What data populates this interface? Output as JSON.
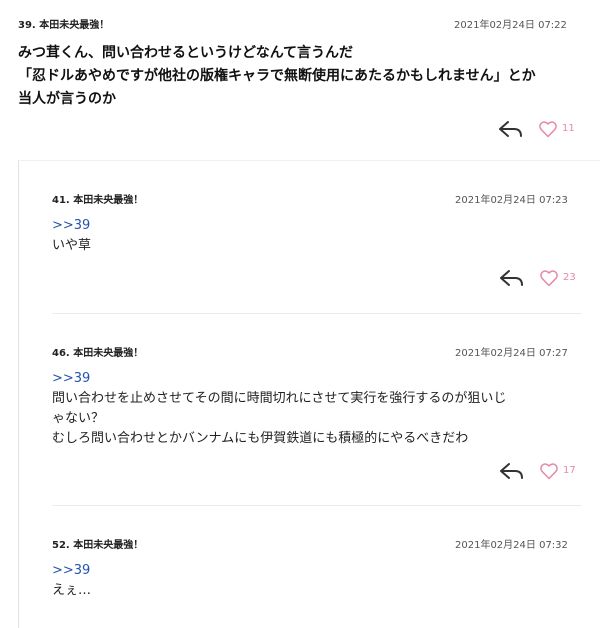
{
  "top_comment": {
    "number": "39.",
    "author": "本田未央最強！",
    "date": "2021年02月24日 07:22",
    "lines": [
      "みつ茸くん、問い合わせるというけどなんて言うんだ",
      "「忍ドルあやめですが他社の版権キャラで無断使用にあたるかもしれません」とか",
      "当人が言うのか"
    ],
    "likes": "11"
  },
  "replies": [
    {
      "number": "41.",
      "author": "本田未央最強！",
      "date": "2021年02月24日 07:23",
      "anchor": ">>39",
      "lines": [
        "いや草"
      ],
      "likes": "23"
    },
    {
      "number": "46.",
      "author": "本田未央最強！",
      "date": "2021年02月24日 07:27",
      "anchor": ">>39",
      "lines": [
        "問い合わせを止めさせてその間に時間切れにさせて実行を強行するのが狙いじ",
        "ゃない？",
        "むしろ問い合わせとかバンナムにも伊賀鉄道にも積極的にやるべきだわ"
      ],
      "likes": "17"
    },
    {
      "number": "52.",
      "author": "本田未央最強！",
      "date": "2021年02月24日 07:32",
      "anchor": ">>39",
      "lines": [
        "えぇ…"
      ]
    }
  ],
  "colors": {
    "heart": "#e889a6",
    "anchor": "#2255aa",
    "reply_arrow": "#333333"
  },
  "icons": {
    "reply": "reply-arrow-icon",
    "like": "heart-outline-icon"
  }
}
